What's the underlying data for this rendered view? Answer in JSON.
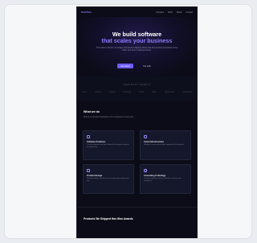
{
  "nav": {
    "logo_main": "Dark",
    "logo_accent": "Site",
    "links": [
      "Services",
      "Work",
      "About",
      "Contact"
    ]
  },
  "hero": {
    "title_line1": "We build software",
    "title_line2": "that scales your business",
    "subtitle": "From idea to launch, we design and develop digital products that help growing companies move faster and serve customers better.",
    "cta_primary": "Get started",
    "cta_secondary": "Our work"
  },
  "trusted": {
    "label": "TRUSTED BY TEAMS AT",
    "logos": [
      "Acme",
      "Globex",
      "Initech",
      "Umbrella",
      "Hooli",
      "Stark",
      "Wayne Ent.",
      "Cyberdyne"
    ]
  },
  "services": {
    "title": "What we do",
    "subtitle": "End-to-end product development for companies of every size.",
    "items": [
      {
        "title": "Software Solutions",
        "desc": "Custom platforms and tools tailored to how your business actually works."
      },
      {
        "title": "Cloud Infrastructure",
        "desc": "Reliable, secure and scalable systems built for growth."
      },
      {
        "title": "Product Design",
        "desc": "Research-driven interfaces that people enjoy using every day."
      },
      {
        "title": "Consulting & Strategy",
        "desc": "Technical guidance to plan, prioritize and ship with confidence."
      }
    ]
  },
  "products": {
    "title": "Products We Shipped Has Won Awards"
  },
  "colors": {
    "accent": "#6d5dfc",
    "background": "#0b0c17"
  }
}
